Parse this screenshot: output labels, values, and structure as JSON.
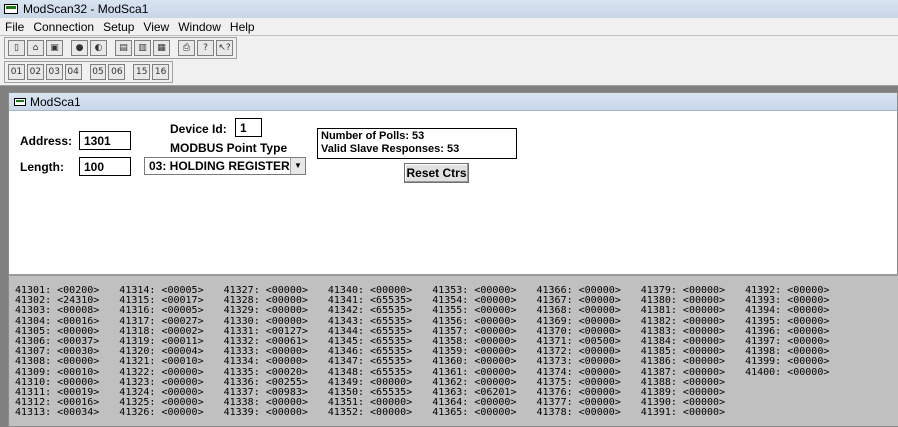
{
  "window": {
    "title": "ModScan32 - ModSca1"
  },
  "menu": [
    "File",
    "Connection",
    "Setup",
    "View",
    "Window",
    "Help"
  ],
  "toolbar1": [
    "new-icon",
    "open-icon",
    "save-icon",
    "connect-icon",
    "disconnect-icon",
    "print-setup-icon",
    "display-icon",
    "window-icon",
    "print-icon",
    "help-icon",
    "context-help-icon"
  ],
  "toolbar2": [
    "coil-01-icon",
    "input-02-icon",
    "register-03-icon",
    "input-04-icon",
    "write-05-icon",
    "write-06-icon",
    "write-15-icon",
    "write-16-icon"
  ],
  "child": {
    "title": "ModSca1",
    "address_label": "Address:",
    "address_value": "1301",
    "length_label": "Length:",
    "length_value": "100",
    "device_id_label": "Device Id:",
    "device_id_value": "1",
    "point_type_label": "MODBUS Point Type",
    "point_type_value": "03: HOLDING REGISTER",
    "polls": "Number of Polls: 53",
    "responses": "Valid Slave Responses: 53",
    "reset_label": "Reset Ctrs"
  },
  "registers": [
    "41301: <00200>",
    "41302: <24310>",
    "41303: <00008>",
    "41304: <00016>",
    "41305: <00000>",
    "41306: <00037>",
    "41307: <00030>",
    "41308: <00000>",
    "41309: <00010>",
    "41310: <00000>",
    "41311: <00019>",
    "41312: <00016>",
    "41313: <00034>",
    "41314: <00005>",
    "41315: <00017>",
    "41316: <00005>",
    "41317: <00027>",
    "41318: <00002>",
    "41319: <00011>",
    "41320: <00004>",
    "41321: <00010>",
    "41322: <00000>",
    "41323: <00000>",
    "41324: <00000>",
    "41325: <00000>",
    "41326: <00000>",
    "41327: <00000>",
    "41328: <00000>",
    "41329: <00000>",
    "41330: <00000>",
    "41331: <00127>",
    "41332: <00061>",
    "41333: <00000>",
    "41334: <00000>",
    "41335: <00020>",
    "41336: <00255>",
    "41337: <00983>",
    "41338: <00000>",
    "41339: <00000>",
    "41340: <00000>",
    "41341: <65535>",
    "41342: <65535>",
    "41343: <65535>",
    "41344: <65535>",
    "41345: <65535>",
    "41346: <65535>",
    "41347: <65535>",
    "41348: <65535>",
    "41349: <00000>",
    "41350: <65535>",
    "41351: <00000>",
    "41352: <00000>",
    "41353: <00000>",
    "41354: <00000>",
    "41355: <00000>",
    "41356: <00000>",
    "41357: <00000>",
    "41358: <00000>",
    "41359: <00000>",
    "41360: <00000>",
    "41361: <00000>",
    "41362: <00000>",
    "41363: <06201>",
    "41364: <00000>",
    "41365: <00000>",
    "41366: <00000>",
    "41367: <00000>",
    "41368: <00000>",
    "41369: <00000>",
    "41370: <00000>",
    "41371: <00500>",
    "41372: <00000>",
    "41373: <00000>",
    "41374: <00000>",
    "41375: <00000>",
    "41376: <00000>",
    "41377: <00000>",
    "41378: <00000>",
    "41379: <00000>",
    "41380: <00000>",
    "41381: <00000>",
    "41382: <00000>",
    "41383: <00000>",
    "41384: <00000>",
    "41385: <00000>",
    "41386: <00000>",
    "41387: <00000>",
    "41388: <00000>",
    "41389: <00000>",
    "41390: <00000>",
    "41391: <00000>",
    "41392: <00000>",
    "41393: <00000>",
    "41394: <00000>",
    "41395: <00000>",
    "41396: <00000>",
    "41397: <00000>",
    "41398: <00000>",
    "41399: <00000>",
    "41400: <00000>"
  ]
}
